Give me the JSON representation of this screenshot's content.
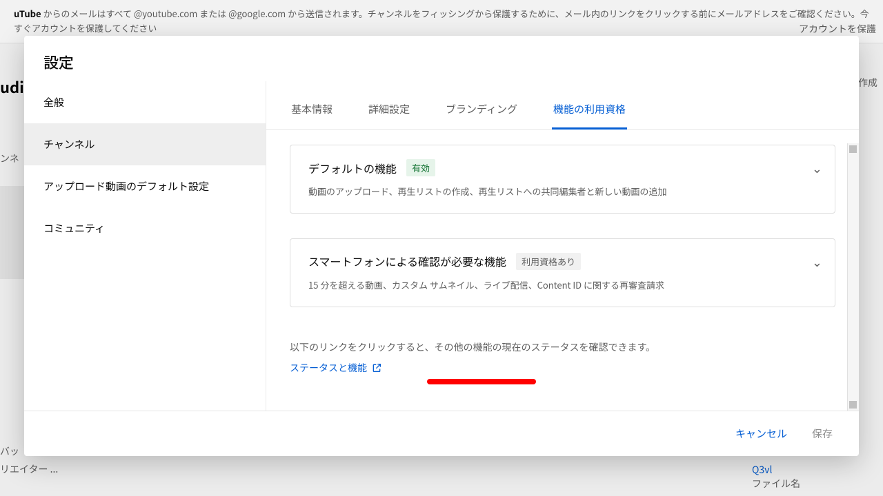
{
  "bg": {
    "banner_prefix": "uTube",
    "banner_text": " からのメールはすべて @youtube.com または @google.com から送信されます。チャンネルをフィッシングから保護するために、メール内のリンクをクリックする前にメールアドレスをご確認ください。今すぐアカウントを保護してください",
    "top_right": "アカウントを保護",
    "logo": "udi",
    "left_word": "ンネ",
    "create": "作成",
    "bottom1": "バッ",
    "bottom2": "リエイター ...",
    "bottom_right_label": "ファイル名",
    "bottom_right_link_frag": "Q3vl"
  },
  "modal": {
    "title": "設定",
    "sidebar": {
      "items": [
        {
          "label": "全般"
        },
        {
          "label": "チャンネル"
        },
        {
          "label": "アップロード動画のデフォルト設定"
        },
        {
          "label": "コミュニティ"
        }
      ],
      "active_index": 1
    },
    "tabs": [
      {
        "label": "基本情報"
      },
      {
        "label": "詳細設定"
      },
      {
        "label": "ブランディング"
      },
      {
        "label": "機能の利用資格"
      }
    ],
    "active_tab_index": 3,
    "cards": [
      {
        "title": "デフォルトの機能",
        "badge": "有効",
        "badge_kind": "green",
        "desc": "動画のアップロード、再生リストの作成、再生リストへの共同編集者と新しい動画の追加"
      },
      {
        "title": "スマートフォンによる確認が必要な機能",
        "badge": "利用資格あり",
        "badge_kind": "grey",
        "desc": "15 分を超える動画、カスタム サムネイル、ライブ配信、Content ID に関する再審査請求"
      }
    ],
    "footnote": "以下のリンクをクリックすると、その他の機能の現在のステータスを確認できます。",
    "status_link": "ステータスと機能",
    "footer": {
      "cancel": "キャンセル",
      "save": "保存"
    }
  }
}
